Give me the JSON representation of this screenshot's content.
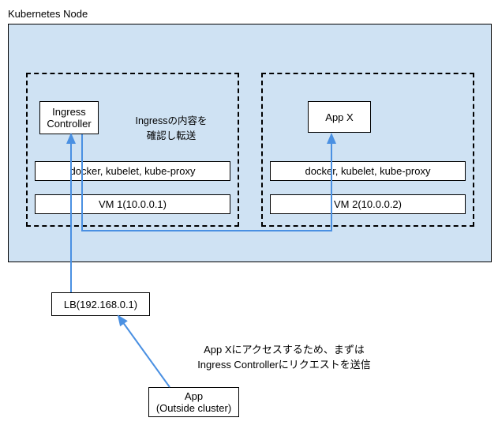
{
  "title": "Kubernetes Node",
  "vm1": {
    "ingress_label": "Ingress\nController",
    "ingress_note": "Ingressの内容を\n確認し転送",
    "services": "docker, kubelet, kube-proxy",
    "vm_label": "VM 1(10.0.0.1)"
  },
  "vm2": {
    "app_label": "App X",
    "services": "docker, kubelet, kube-proxy",
    "vm_label": "VM 2(10.0.0.2)"
  },
  "lb": {
    "label": "LB(192.168.0.1)"
  },
  "client": {
    "label": "App\n(Outside cluster)"
  },
  "note_bottom": "App Xにアクセスするため、まずは\nIngress Controllerにリクエストを送信"
}
